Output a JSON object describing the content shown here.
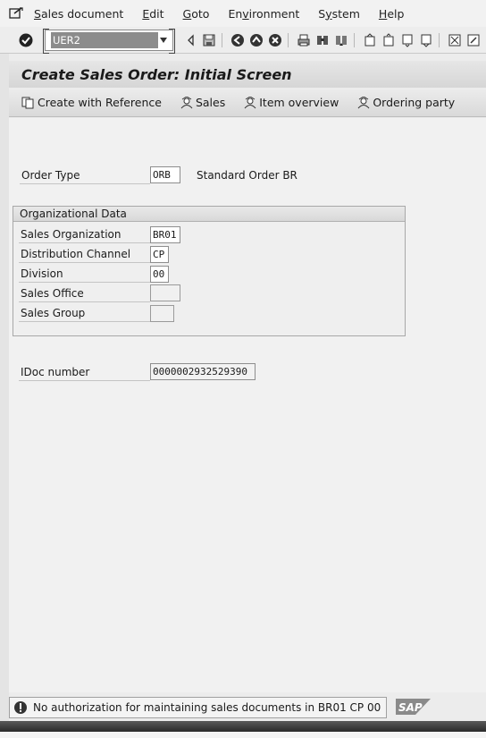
{
  "menu": {
    "items": [
      {
        "label": "Sales document",
        "underline": "S"
      },
      {
        "label": "Edit",
        "underline": "E"
      },
      {
        "label": "Goto",
        "underline": "G"
      },
      {
        "label": "Environment",
        "underline": "v"
      },
      {
        "label": "System",
        "underline": "y"
      },
      {
        "label": "Help",
        "underline": "H"
      }
    ]
  },
  "toolbar": {
    "command_value": "UER2"
  },
  "title": "Create Sales Order: Initial Screen",
  "app_toolbar": {
    "create_with_reference": "Create with Reference",
    "sales": "Sales",
    "item_overview": "Item overview",
    "ordering_party": "Ordering party"
  },
  "form": {
    "order_type_label": "Order Type",
    "order_type_value": "ORB",
    "order_type_desc": "Standard Order BR",
    "org_group_title": "Organizational Data",
    "sales_org_label": "Sales Organization",
    "sales_org_value": "BR01",
    "dist_channel_label": "Distribution Channel",
    "dist_channel_value": "CP",
    "division_label": "Division",
    "division_value": "00",
    "sales_office_label": "Sales Office",
    "sales_office_value": "",
    "sales_group_label": "Sales Group",
    "sales_group_value": "",
    "idoc_label": "IDoc number",
    "idoc_value": "0000002932529390"
  },
  "status": {
    "message": "No authorization for maintaining sales documents in BR01 CP 00",
    "logo": "SAP"
  },
  "icons": {
    "menu_app": "sap-menu-icon",
    "enter": "checkmark-icon",
    "save": "save-icon",
    "back": "back-icon",
    "exit": "exit-icon",
    "cancel": "cancel-icon",
    "print": "print-icon",
    "find": "find-icon",
    "find_next": "find-next-icon",
    "warning": "warning-icon"
  }
}
